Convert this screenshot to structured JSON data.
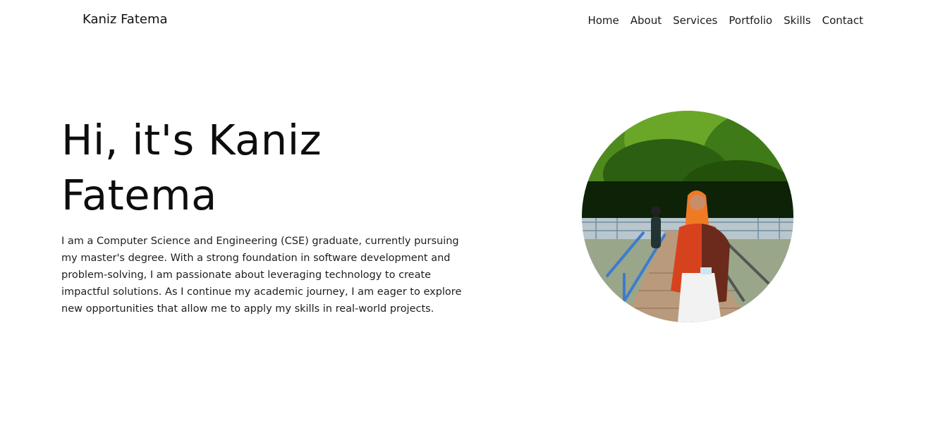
{
  "header": {
    "brand": "Kaniz Fatema",
    "nav": [
      {
        "label": "Home"
      },
      {
        "label": "About"
      },
      {
        "label": "Services"
      },
      {
        "label": "Portfolio"
      },
      {
        "label": "Skills"
      },
      {
        "label": "Contact"
      }
    ]
  },
  "hero": {
    "title": "Hi, it's Kaniz Fatema",
    "description": "I am a Computer Science and Engineering (CSE) graduate, currently pursuing my master's degree. With a strong foundation in software development and problem-solving, I am passionate about leveraging technology to create impactful solutions. As I continue my academic journey, I am eager to explore new opportunities that allow me to apply my skills in real-world projects."
  }
}
